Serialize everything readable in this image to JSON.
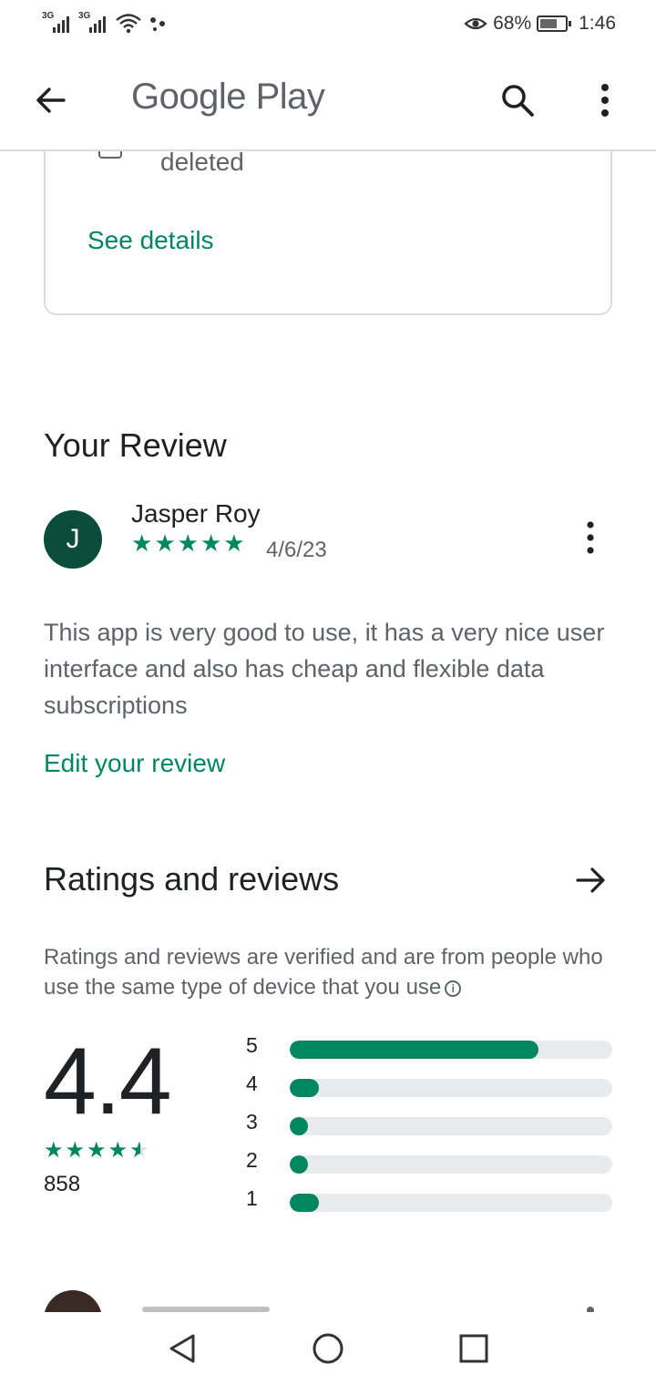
{
  "status_bar": {
    "signal1": "3G",
    "signal2": "3G",
    "battery": "68%",
    "time": "1:46"
  },
  "app_bar": {
    "title": "Google Play"
  },
  "card": {
    "checkbox_text": "deleted",
    "link": "See details"
  },
  "your_review": {
    "heading": "Your Review",
    "avatar_letter": "J",
    "name": "Jasper Roy",
    "stars": 5,
    "date": "4/6/23",
    "text": "This app is very good to use, it has a very nice user interface and also has cheap and flexible data subscriptions",
    "edit_link": "Edit your review"
  },
  "ratings": {
    "heading": "Ratings and reviews",
    "verified_note": "Ratings and reviews are verified and are from people who use the same type of device that you use",
    "average": "4.4",
    "count": "858",
    "stars_value": 4.5,
    "distribution": [
      {
        "label": "5",
        "fraction": 0.77
      },
      {
        "label": "4",
        "fraction": 0.09
      },
      {
        "label": "3",
        "fraction": 0.05
      },
      {
        "label": "2",
        "fraction": 0.05
      },
      {
        "label": "1",
        "fraction": 0.09
      }
    ]
  },
  "colors": {
    "accent": "#01875f",
    "text_primary": "#202124",
    "text_secondary": "#5f6368",
    "divider": "#dadce0"
  },
  "icons": [
    "back-arrow-icon",
    "search-icon",
    "more-vert-icon",
    "arrow-right-icon",
    "info-icon",
    "nav-back-icon",
    "nav-home-icon",
    "nav-recents-icon"
  ]
}
